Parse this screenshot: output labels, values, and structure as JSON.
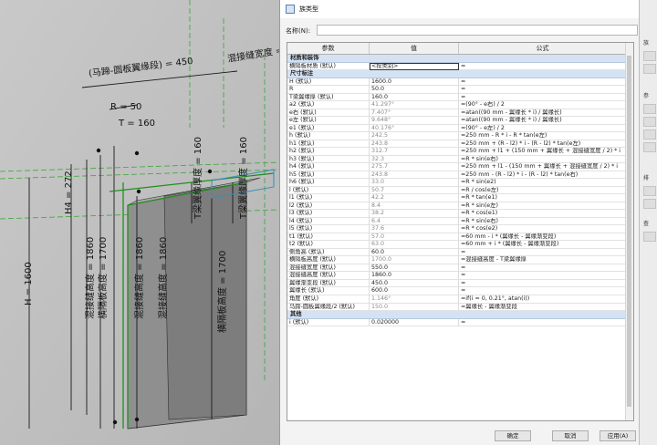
{
  "cad": {
    "dims": [
      "(马蹄-圆板翼缘段) = 450",
      "R = 50",
      "T = 160",
      "H4 = 272",
      "H = 1600",
      "混接缝高度 = 1860",
      "横隔板高度 = 1700",
      "T梁翼缘厚度 = 160",
      "混接缝宽度 = 450"
    ]
  },
  "dialog": {
    "title": "族类型",
    "name_label": "名称(N):",
    "columns": [
      "参数",
      "值",
      "公式"
    ],
    "groups": {
      "materials": "材质和装饰",
      "dimensions": "尺寸标注",
      "other": "其他"
    },
    "material_row": {
      "param": "横隔板材质 (默认)",
      "value": "<按类别>",
      "formula": "="
    },
    "rows": [
      {
        "p": "H (默认)",
        "v": "1600.0",
        "f": "=",
        "g": false
      },
      {
        "p": "R",
        "v": "50.0",
        "f": "=",
        "g": false
      },
      {
        "p": "T梁翼缘厚 (默认)",
        "v": "160.0",
        "f": "=",
        "g": false
      },
      {
        "p": "a2 (默认)",
        "v": "41.297°",
        "f": "=(90° - e右) / 2",
        "g": true
      },
      {
        "p": "e右 (默认)",
        "v": "7.407°",
        "f": "=atan((90 mm - 翼缘长 * i) / 翼缘长)",
        "g": true
      },
      {
        "p": "e左 (默认)",
        "v": "9.648°",
        "f": "=atan((90 mm - 翼缘长 * i) / 翼缘长)",
        "g": true
      },
      {
        "p": "e1 (默认)",
        "v": "40.176°",
        "f": "=(90° - e左) / 2",
        "g": true
      },
      {
        "p": "h (默认)",
        "v": "242.5",
        "f": "=250 mm - R * i - R * tan(e左)",
        "g": true
      },
      {
        "p": "h1 (默认)",
        "v": "243.8",
        "f": "=250 mm + (R - l2) * i - (R - l2) * tan(e左)",
        "g": true
      },
      {
        "p": "h2 (默认)",
        "v": "312.7",
        "f": "=250 mm + l1 + (150 mm + 翼缘长 + 混接缝宽度 / 2) * i",
        "g": true
      },
      {
        "p": "h3 (默认)",
        "v": "32.3",
        "f": "=R * sin(e右)",
        "g": true
      },
      {
        "p": "h4 (默认)",
        "v": "275.7",
        "f": "=250 mm + l1 - (150 mm + 翼缘长 + 混接缝宽度 / 2) * i",
        "g": true
      },
      {
        "p": "h5 (默认)",
        "v": "243.8",
        "f": "=250 mm - (R - l2) * i - (R - l2) * tan(e右)",
        "g": true
      },
      {
        "p": "h6 (默认)",
        "v": "33.0",
        "f": "=R * sin(e2)",
        "g": true
      },
      {
        "p": "l (默认)",
        "v": "50.7",
        "f": "=R / cos(e左)",
        "g": true
      },
      {
        "p": "l1 (默认)",
        "v": "42.2",
        "f": "=R * tan(e1)",
        "g": true
      },
      {
        "p": "l2 (默认)",
        "v": "8.4",
        "f": "=R * sin(e左)",
        "g": true
      },
      {
        "p": "l3 (默认)",
        "v": "38.2",
        "f": "=R * cos(e1)",
        "g": true
      },
      {
        "p": "l4 (默认)",
        "v": "6.4",
        "f": "=R * sin(e右)",
        "g": true
      },
      {
        "p": "l5 (默认)",
        "v": "37.6",
        "f": "=R * cos(e2)",
        "g": true
      },
      {
        "p": "t1 (默认)",
        "v": "57.0",
        "f": "=60 mm - i * (翼缘长 - 翼缘渐变段)",
        "g": true
      },
      {
        "p": "t2 (默认)",
        "v": "63.0",
        "f": "=60 mm + i * (翼缘长 - 翼缘渐变段)",
        "g": true
      },
      {
        "p": "侧角高 (默认)",
        "v": "60.0",
        "f": "=",
        "g": false
      },
      {
        "p": "横隔板高度 (默认)",
        "v": "1700.0",
        "f": "=混接缝高度 - T梁翼缘厚",
        "g": true
      },
      {
        "p": "混接缝宽度 (默认)",
        "v": "550.0",
        "f": "=",
        "g": false
      },
      {
        "p": "混接缝高度 (默认)",
        "v": "1860.0",
        "f": "=",
        "g": false
      },
      {
        "p": "翼缘渐变段 (默认)",
        "v": "450.0",
        "f": "=",
        "g": false
      },
      {
        "p": "翼缘长 (默认)",
        "v": "600.0",
        "f": "=",
        "g": false
      },
      {
        "p": "角度 (默认)",
        "v": "1.146°",
        "f": "=if(i = 0, 0.21°, atan(i))",
        "g": true
      },
      {
        "p": "马蹄-圆板翼缘段/2 (默认)",
        "v": "150.0",
        "f": "=翼缘长 - 翼缘渐变段",
        "g": true
      }
    ],
    "other_row": {
      "param": "i (默认)",
      "value": "0.020000",
      "formula": "="
    },
    "buttons": {
      "ok": "确定",
      "cancel": "取消",
      "apply": "应用(A)"
    },
    "right_labels": [
      "族",
      "参",
      "排",
      "查"
    ]
  }
}
